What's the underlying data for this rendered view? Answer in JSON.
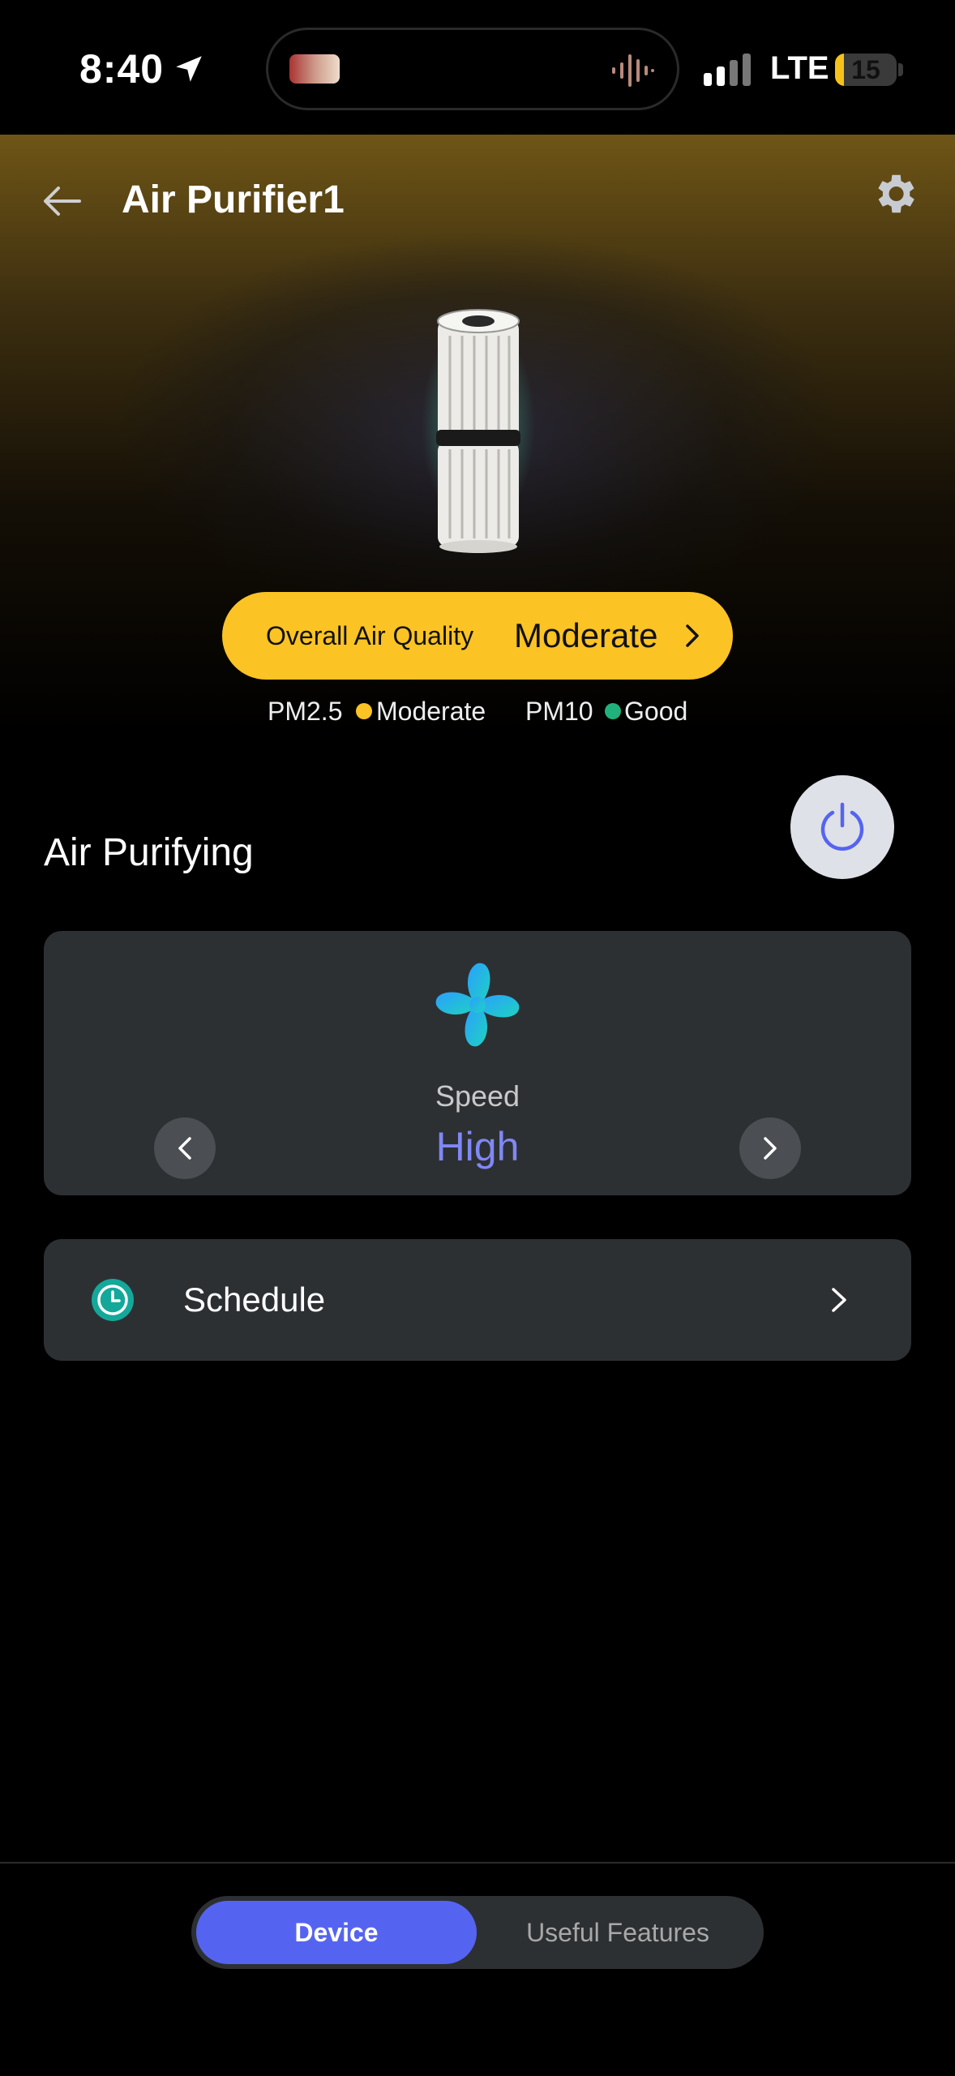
{
  "status_bar": {
    "time": "8:40",
    "network": "LTE",
    "battery": "15",
    "battery_level": 0.15
  },
  "header": {
    "title": "Air Purifier1"
  },
  "air_quality": {
    "label": "Overall Air Quality",
    "value": "Moderate",
    "pm25_label": "PM2.5",
    "pm25_value": "Moderate",
    "pm10_label": "PM10",
    "pm10_value": "Good",
    "colors": {
      "moderate": "#fbc324",
      "good": "#21b27b"
    }
  },
  "section": {
    "title": "Air Purifying"
  },
  "speed": {
    "label": "Speed",
    "value": "High"
  },
  "schedule": {
    "label": "Schedule"
  },
  "tabs": [
    {
      "label": "Device",
      "active": true
    },
    {
      "label": "Useful Features",
      "active": false
    }
  ],
  "accent_color": "#5564f0"
}
